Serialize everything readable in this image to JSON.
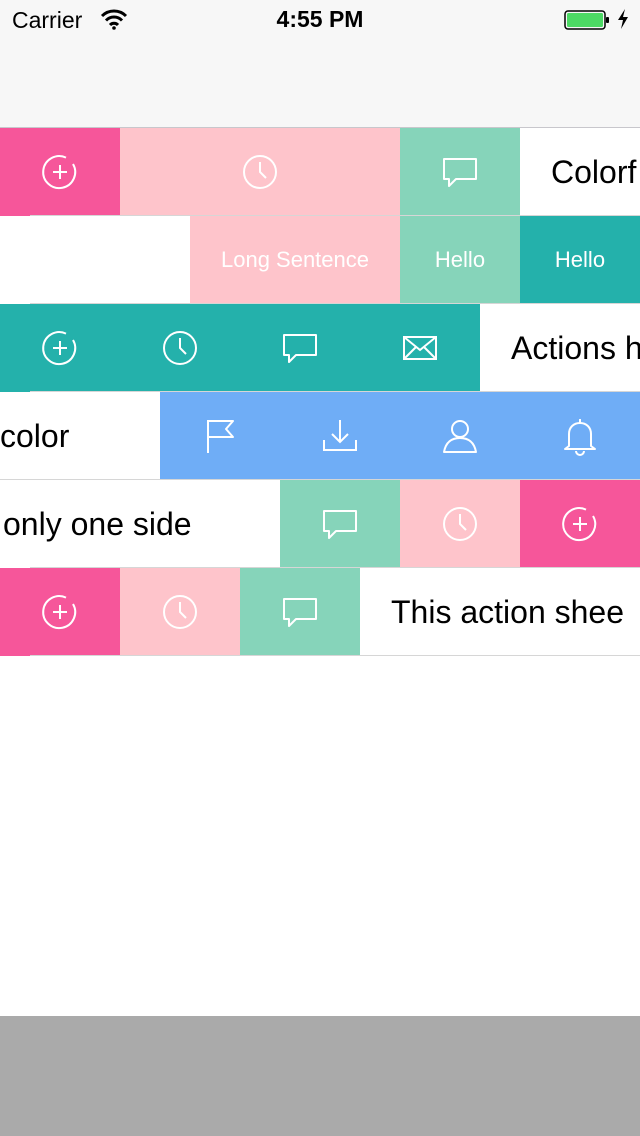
{
  "status_bar": {
    "carrier": "Carrier",
    "time": "4:55 PM"
  },
  "colors": {
    "pink": "#f6569a",
    "light_pink": "#fec4cb",
    "mint": "#86d4ba",
    "teal": "#24b1ab",
    "blue": "#6fadf6",
    "gray": "#aaaaaa"
  },
  "rows": [
    {
      "text": "Colorf",
      "buttons": [
        "add-circle-icon",
        "clock-icon",
        "comment-icon"
      ]
    },
    {
      "buttons": [
        "Long Sentence",
        "Hello",
        "Hello"
      ]
    },
    {
      "text": "Actions h",
      "buttons": [
        "add-circle-icon",
        "clock-icon",
        "comment-icon",
        "mail-icon"
      ]
    },
    {
      "text": "color",
      "buttons": [
        "flag-icon",
        "download-icon",
        "user-icon",
        "bell-icon"
      ]
    },
    {
      "text": "only one side",
      "buttons": [
        "comment-icon",
        "clock-icon",
        "add-circle-icon"
      ]
    },
    {
      "text": "This action shee",
      "buttons": [
        "add-circle-icon",
        "clock-icon",
        "comment-icon"
      ]
    }
  ]
}
